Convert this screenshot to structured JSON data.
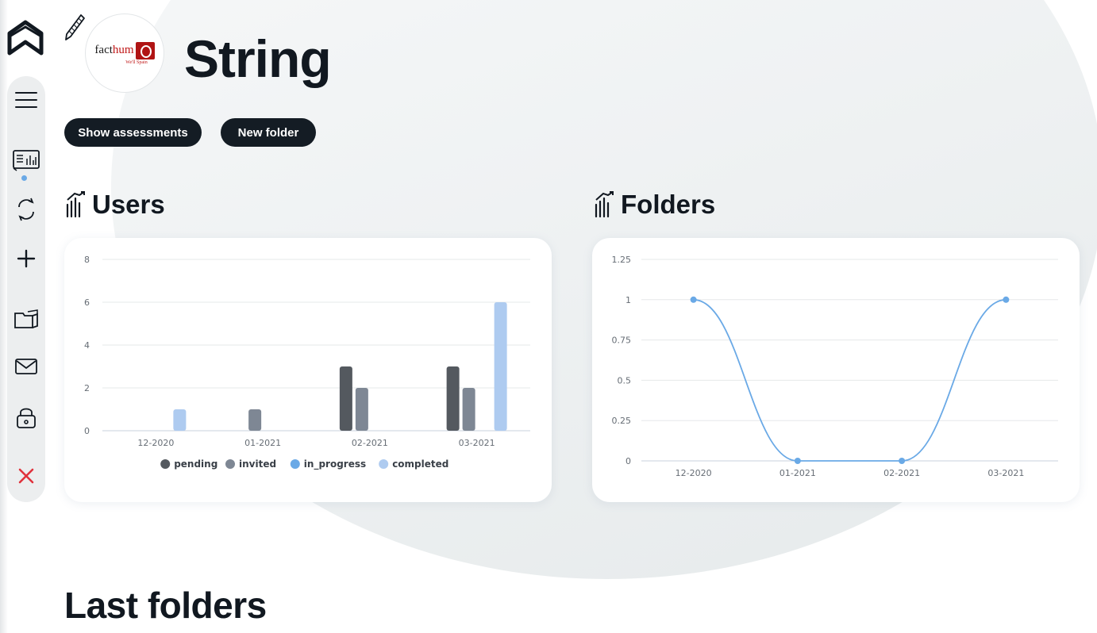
{
  "header": {
    "title": "String",
    "avatar": {
      "brand_prefix": "fact",
      "brand_suffix": "hum",
      "tagline": "We'll Spain"
    }
  },
  "toolbar": {
    "show_assessments_label": "Show assessments",
    "new_folder_label": "New folder"
  },
  "sidebar": {
    "items": [
      {
        "name": "menu-icon"
      },
      {
        "name": "dashboard-icon",
        "active": true
      },
      {
        "name": "sync-icon"
      },
      {
        "name": "plus-icon"
      },
      {
        "name": "folders-icon"
      },
      {
        "name": "mail-icon"
      },
      {
        "name": "lock-icon"
      },
      {
        "name": "close-icon"
      }
    ],
    "active_dot_color": "#6aa9e6",
    "close_color": "#e0323c"
  },
  "sections": {
    "users_title": "Users",
    "folders_title": "Folders",
    "last_folders_title": "Last folders"
  },
  "chart_data": [
    {
      "type": "bar",
      "categories": [
        "12-2020",
        "01-2021",
        "02-2021",
        "03-2021"
      ],
      "series": [
        {
          "name": "pending",
          "values": [
            0,
            0,
            3,
            3
          ],
          "color": "#54595f"
        },
        {
          "name": "invited",
          "values": [
            0,
            1,
            2,
            2
          ],
          "color": "#7e8794"
        },
        {
          "name": "in_progress",
          "values": [
            0,
            0,
            0,
            0
          ],
          "color": "#6aa9e6"
        },
        {
          "name": "completed",
          "values": [
            1,
            0,
            0,
            6
          ],
          "color": "#aecbf0"
        }
      ],
      "yticks": [
        "0",
        "2",
        "4",
        "6",
        "8"
      ],
      "ylim": [
        0,
        8
      ],
      "grid": true,
      "legend": "bottom-center"
    },
    {
      "type": "line",
      "x": [
        "12-2020",
        "01-2021",
        "02-2021",
        "03-2021"
      ],
      "series": [
        {
          "values": [
            1,
            0,
            0,
            1
          ],
          "color": "#6aa9e6"
        }
      ],
      "yticks": [
        "0",
        "0.25",
        "0.5",
        "0.75",
        "1",
        "1.25"
      ],
      "ylim": [
        0,
        1.25
      ],
      "grid": true,
      "legend": "none"
    }
  ]
}
